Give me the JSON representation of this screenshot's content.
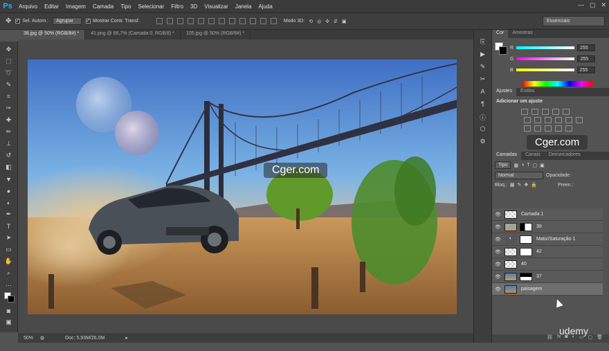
{
  "app": {
    "logo": "Ps"
  },
  "menu": [
    "Arquivo",
    "Editar",
    "Imagem",
    "Camada",
    "Tipo",
    "Selecionar",
    "Filtro",
    "3D",
    "Visualizar",
    "Janela",
    "Ajuda"
  ],
  "window_buttons": [
    "—",
    "▢",
    "✕"
  ],
  "options": {
    "auto_select_label": "Sel. Autom.:",
    "auto_select_value": "Agrupar",
    "show_transform_label": "Mostrar Contr. Transf.",
    "mode3d_label": "Modo 3D:",
    "workspace": "Essenciais"
  },
  "doc_tabs": [
    "38.jpg @ 50% (RGB/8#) *",
    "41.png @ 66,7% (Camada 0, RGB/8) *",
    "105.jpg @ 50% (RGB/8#) *"
  ],
  "watermark_canvas": "Cger.com",
  "watermark_panel": "Cger.com",
  "status": {
    "zoom": "50%",
    "doc": "Doc: 5,93M/26,0M"
  },
  "panels": {
    "color_tabs": [
      "Cor",
      "Amostras"
    ],
    "color": {
      "r_label": "R",
      "g_label": "G",
      "b_label": "B",
      "r": "255",
      "g": "255",
      "b": "255"
    },
    "adjust_tabs": [
      "Ajustes",
      "Estilos"
    ],
    "adjust_title": "Adicionar um ajuste",
    "layers_tabs": [
      "Camadas",
      "Canais",
      "Demarcadores"
    ],
    "filter_kind": "Tipo",
    "blend_mode": "Normal",
    "opacity_label": "Opacidade:",
    "lock_label": "Bloq.:",
    "fill_label": "Preen.:",
    "layers": [
      {
        "name": "Camada 1",
        "thumb": "checker",
        "mask": false
      },
      {
        "name": "39",
        "thumb": "photo",
        "mask": true
      },
      {
        "name": "Matiz/Saturação 1",
        "thumb": "adjust",
        "mask": true
      },
      {
        "name": "42",
        "thumb": "checker",
        "mask": true
      },
      {
        "name": "40",
        "thumb": "checker",
        "mask": false
      },
      {
        "name": "37",
        "thumb": "photo",
        "mask": true
      },
      {
        "name": "paisagem",
        "thumb": "photo",
        "mask": false
      }
    ]
  },
  "brand": "udemy"
}
